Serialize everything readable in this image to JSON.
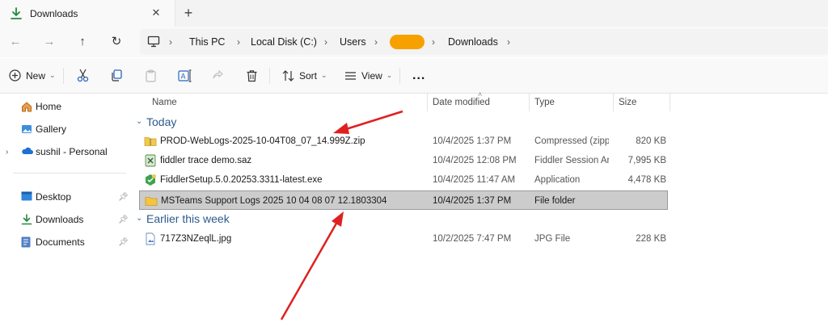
{
  "window": {
    "tab_title": "Downloads"
  },
  "address": {
    "crumbs": [
      "This PC",
      "Local Disk (C:)",
      "Users",
      "Downloads"
    ],
    "user_pill_color": "#f6a100"
  },
  "toolbar": {
    "new_label": "New",
    "sort_label": "Sort",
    "view_label": "View",
    "more_label": "..."
  },
  "sidebar": {
    "items": [
      {
        "label": "Home",
        "icon": "home-icon"
      },
      {
        "label": "Gallery",
        "icon": "gallery-icon"
      },
      {
        "label": "sushil - Personal",
        "icon": "onedrive-cloud-icon"
      },
      {
        "label": "Desktop",
        "icon": "desktop-icon"
      },
      {
        "label": "Downloads",
        "icon": "download-icon"
      },
      {
        "label": "Documents",
        "icon": "documents-icon"
      }
    ]
  },
  "columns": {
    "name": "Name",
    "date": "Date modified",
    "type": "Type",
    "size": "Size"
  },
  "groups": [
    {
      "label": "Today",
      "files": [
        {
          "name": "PROD-WebLogs-2025-10-04T08_07_14.999Z.zip",
          "date": "10/4/2025 1:37 PM",
          "type": "Compressed (zipp...",
          "size": "820 KB",
          "icon": "zip-folder-icon"
        },
        {
          "name": "fiddler trace demo.saz",
          "date": "10/4/2025 12:08 PM",
          "type": "Fiddler Session Ar...",
          "size": "7,995 KB",
          "icon": "fiddler-archive-icon"
        },
        {
          "name": "FiddlerSetup.5.0.20253.3311-latest.exe",
          "date": "10/4/2025 11:47 AM",
          "type": "Application",
          "size": "4,478 KB",
          "icon": "installer-icon"
        },
        {
          "name": "MSTeams Support Logs 2025 10 04 08 07 12.1803304",
          "date": "10/4/2025 1:37 PM",
          "type": "File folder",
          "size": "",
          "icon": "folder-icon"
        }
      ]
    },
    {
      "label": "Earlier this week",
      "files": [
        {
          "name": "717Z3NZeqlL.jpg",
          "date": "10/2/2025 7:47 PM",
          "type": "JPG File",
          "size": "228 KB",
          "icon": "image-file-icon"
        }
      ]
    }
  ],
  "colors": {
    "accent": "#2c5a8c",
    "annotation_arrow": "#e02020",
    "selection": "#cccccc"
  }
}
